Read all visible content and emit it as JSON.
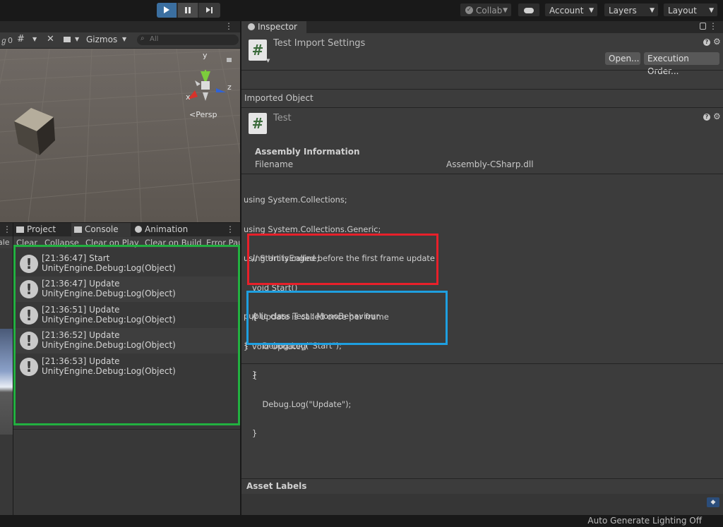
{
  "toolbar": {
    "collab_label": "Collab",
    "account_label": "Account",
    "layers_label": "Layers",
    "layout_label": "Layout"
  },
  "scene": {
    "layer_count": "0",
    "gizmos_label": "Gizmos",
    "search_placeholder": "All",
    "axis_y": "y",
    "axis_x": "x",
    "axis_z": "z",
    "persp_label": "Persp"
  },
  "console": {
    "tabs": [
      "Project",
      "Console",
      "Animation"
    ],
    "left_strip_label": "ale",
    "buttons": [
      "Clear",
      "Collapse",
      "Clear on Play",
      "Clear on Build",
      "Error Pau"
    ],
    "logs": [
      {
        "line1": "[21:36:47] Start",
        "line2": "UnityEngine.Debug:Log(Object)"
      },
      {
        "line1": "[21:36:47] Update",
        "line2": "UnityEngine.Debug:Log(Object)"
      },
      {
        "line1": "[21:36:51] Update",
        "line2": "UnityEngine.Debug:Log(Object)"
      },
      {
        "line1": "[21:36:52] Update",
        "line2": "UnityEngine.Debug:Log(Object)"
      },
      {
        "line1": "[21:36:53] Update",
        "line2": "UnityEngine.Debug:Log(Object)"
      }
    ]
  },
  "inspector": {
    "tab_label": "Inspector",
    "title": "Test Import Settings",
    "open_button": "Open...",
    "execution_order_button": "Execution Order...",
    "imported_object_label": "Imported Object",
    "object_name": "Test",
    "assembly_info_label": "Assembly Information",
    "filename_label": "Filename",
    "filename_value": "Assembly-CSharp.dll",
    "code_lines": [
      "using System.Collections;",
      "using System.Collections.Generic;",
      "using UnityEngine;",
      "",
      "public class Test : MonoBehaviour",
      "{"
    ],
    "start_block": [
      "// Start is called before the first frame update",
      "void Start()",
      "{",
      "    Debug.Log(\"Start\");",
      "}"
    ],
    "update_block": [
      "// Update is called once per frame",
      "void Update()",
      "{",
      "    Debug.Log(\"Update\");",
      "}"
    ],
    "closing_brace": "}",
    "asset_labels": "Asset Labels"
  },
  "status": {
    "lighting": "Auto Generate Lighting Off"
  },
  "colors": {
    "highlight_red": "#e8202a",
    "highlight_blue": "#1e9fe0",
    "highlight_green": "#22b040",
    "play_active": "#3b6fa0"
  }
}
